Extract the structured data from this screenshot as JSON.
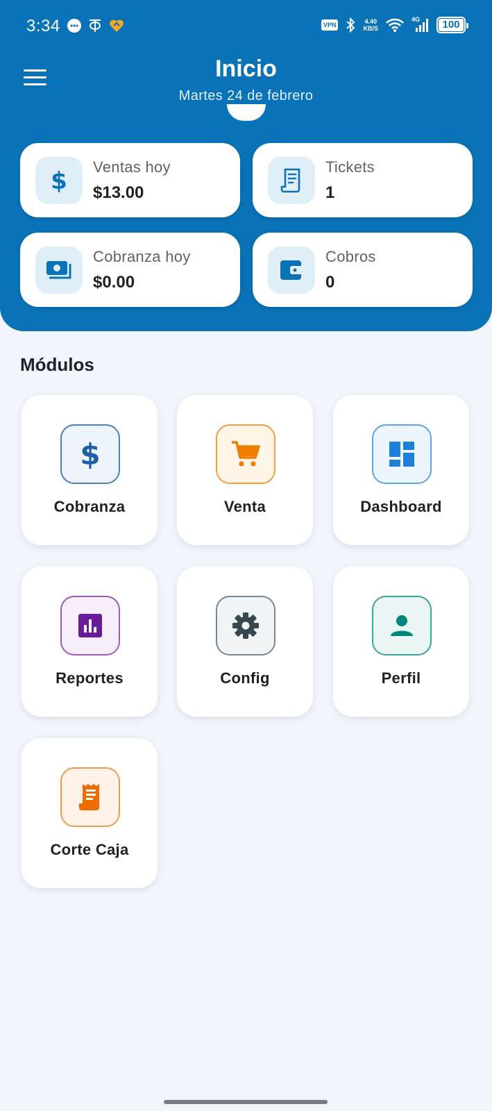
{
  "statusbar": {
    "time": "3:34",
    "vpn": "VPN",
    "speed_value": "4.40",
    "speed_unit": "KB/S",
    "network": "4G",
    "battery": "100"
  },
  "header": {
    "title": "Inicio",
    "date": "Martes 24 de febrero"
  },
  "stats": [
    {
      "label": "Ventas hoy",
      "value": "$13.00",
      "icon": "dollar-icon"
    },
    {
      "label": "Tickets",
      "value": "1",
      "icon": "receipt-icon"
    },
    {
      "label": "Cobranza hoy",
      "value": "$0.00",
      "icon": "cash-icon"
    },
    {
      "label": "Cobros",
      "value": "0",
      "icon": "wallet-icon"
    }
  ],
  "modules_title": "Módulos",
  "modules": [
    {
      "label": "Cobranza",
      "icon": "dollar-icon",
      "color": "#1f5fa8",
      "bg": "#eef4fb",
      "border": "#4a7fc0"
    },
    {
      "label": "Venta",
      "icon": "cart-icon",
      "color": "#f07c00",
      "bg": "#fff4e6",
      "border": "#f0a040"
    },
    {
      "label": "Dashboard",
      "icon": "dashboard-icon",
      "color": "#1e7fd8",
      "bg": "#eef6fd",
      "border": "#5ba4e0"
    },
    {
      "label": "Reportes",
      "icon": "bar-chart-icon",
      "color": "#6a1b9a",
      "bg": "#f6eefa",
      "border": "#9a5bbd"
    },
    {
      "label": "Config",
      "icon": "gear-icon",
      "color": "#37474f",
      "bg": "#f1f3f5",
      "border": "#7a8790"
    },
    {
      "label": "Perfil",
      "icon": "person-icon",
      "color": "#00897b",
      "bg": "#eaf6f4",
      "border": "#3fa396"
    },
    {
      "label": "Corte Caja",
      "icon": "receipt-icon",
      "color": "#ef6c00",
      "bg": "#fff2e8",
      "border": "#ef9a4a"
    }
  ]
}
